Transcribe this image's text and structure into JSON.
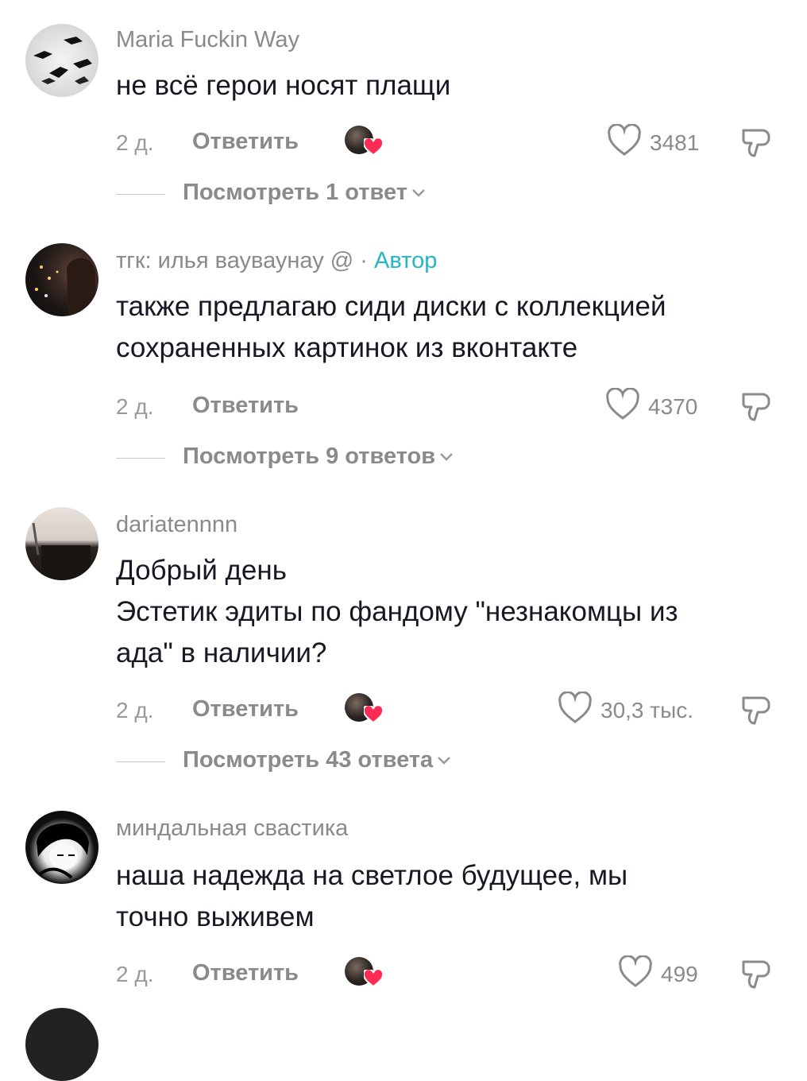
{
  "comments": [
    {
      "username": "Maria Fuckin Way",
      "author_badge": "",
      "text": "не всё герои носят плащи",
      "date": "2 д.",
      "reply_label": "Ответить",
      "likes": "3481",
      "view_replies": "Посмотреть 1 ответ"
    },
    {
      "username": "тгк: илья вауваунау @ · ",
      "author_badge": "Автор",
      "text": "также предлагаю сиди диски с коллекцией\nсохраненных картинок из вконтакте",
      "date": "2 д.",
      "reply_label": "Ответить",
      "likes": "4370",
      "view_replies": "Посмотреть 9 ответов"
    },
    {
      "username": "dariatennnn",
      "author_badge": "",
      "text": "Добрый день\nЭстетик эдиты по фандому \"незнакомцы из\nада\" в наличии?",
      "date": "2 д.",
      "reply_label": "Ответить",
      "likes": "30,3 тыс.",
      "view_replies": "Посмотреть 43 ответа"
    },
    {
      "username": "миндальная свастика",
      "author_badge": "",
      "text": "наша надежда на светлое будущее, мы\nточно выживем",
      "date": "2 д.",
      "reply_label": "Ответить",
      "likes": "499",
      "view_replies": ""
    }
  ],
  "colors": {
    "text": "#161823",
    "muted": "#8a8a8a",
    "author": "#25b6c6",
    "heart": "#fe2c55"
  }
}
